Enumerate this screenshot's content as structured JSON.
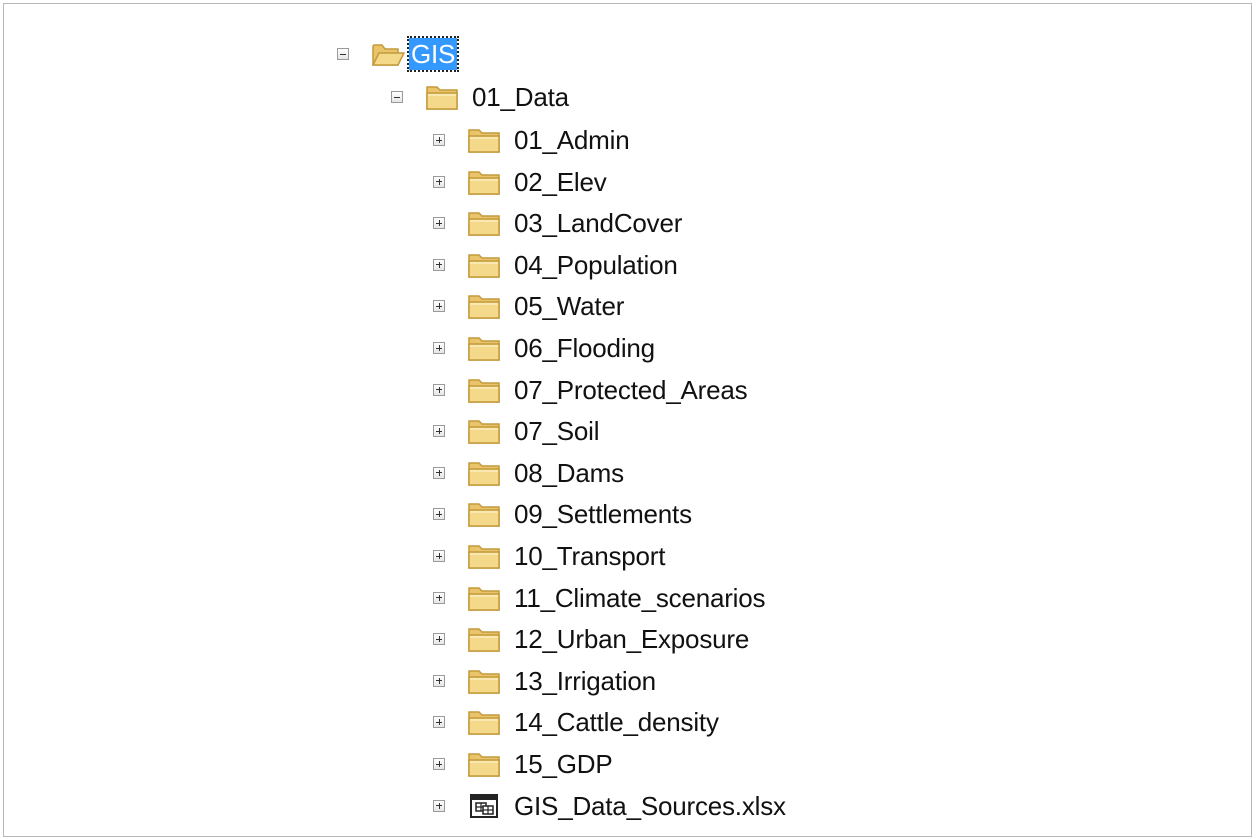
{
  "tree": {
    "root": {
      "label": "GIS",
      "expanded": true,
      "selected": true,
      "icon": "folder-open-icon"
    },
    "data_folder": {
      "label": "01_Data",
      "expanded": true,
      "icon": "folder-icon"
    },
    "children": [
      {
        "label": "01_Admin",
        "icon": "folder-icon",
        "expanded": false
      },
      {
        "label": "02_Elev",
        "icon": "folder-icon",
        "expanded": false
      },
      {
        "label": "03_LandCover",
        "icon": "folder-icon",
        "expanded": false
      },
      {
        "label": "04_Population",
        "icon": "folder-icon",
        "expanded": false
      },
      {
        "label": "05_Water",
        "icon": "folder-icon",
        "expanded": false
      },
      {
        "label": "06_Flooding",
        "icon": "folder-icon",
        "expanded": false
      },
      {
        "label": "07_Protected_Areas",
        "icon": "folder-icon",
        "expanded": false
      },
      {
        "label": "07_Soil",
        "icon": "folder-icon",
        "expanded": false
      },
      {
        "label": "08_Dams",
        "icon": "folder-icon",
        "expanded": false
      },
      {
        "label": "09_Settlements",
        "icon": "folder-icon",
        "expanded": false
      },
      {
        "label": "10_Transport",
        "icon": "folder-icon",
        "expanded": false
      },
      {
        "label": "11_Climate_scenarios",
        "icon": "folder-icon",
        "expanded": false
      },
      {
        "label": "12_Urban_Exposure",
        "icon": "folder-icon",
        "expanded": false
      },
      {
        "label": "13_Irrigation",
        "icon": "folder-icon",
        "expanded": false
      },
      {
        "label": "14_Cattle_density",
        "icon": "folder-icon",
        "expanded": false
      },
      {
        "label": "15_GDP",
        "icon": "folder-icon",
        "expanded": false
      },
      {
        "label": "GIS_Data_Sources.xlsx",
        "icon": "spreadsheet-file-icon",
        "expanded": false
      }
    ]
  },
  "colors": {
    "selection": "#3399ff",
    "folder_fill": "#f4d98a",
    "folder_edge": "#c49a3a"
  }
}
